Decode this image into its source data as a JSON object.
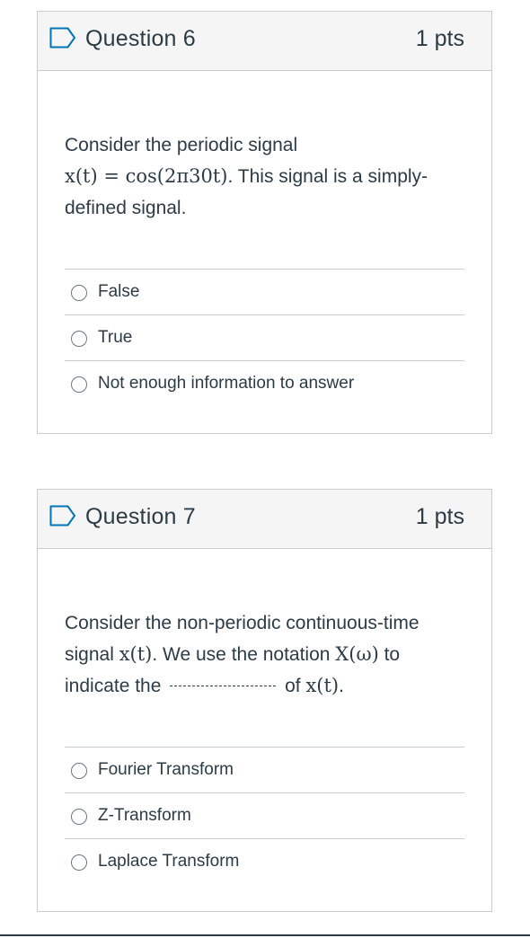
{
  "questions": [
    {
      "title": "Question 6",
      "points": "1 pts",
      "prompt": {
        "line1": "Consider the periodic signal",
        "math": "x(t) = cos(2π30t)",
        "line2_after": ". This signal is a simply-",
        "line3": "defined signal."
      },
      "answers": [
        "False",
        "True",
        "Not enough information to answer"
      ]
    },
    {
      "title": "Question 7",
      "points": "1 pts",
      "prompt": {
        "line1": "Consider the non-periodic continuous-time",
        "line2_before": "signal ",
        "math_signal": "x(t)",
        "line2_mid": ". We use the notation ",
        "math_transform": "X(ω)",
        "line2_after": " to",
        "line3_before": "indicate the ",
        "line3_mid": " of ",
        "math_signal2": "x(t)",
        "line3_after": "."
      },
      "answers": [
        "Fourier Transform",
        "Z-Transform",
        "Laplace Transform"
      ]
    }
  ],
  "icons": {
    "flag": "flag-icon",
    "radio": "radio-icon"
  },
  "colors": {
    "text": "#2d3b45",
    "header_bg": "#f5f5f5",
    "border": "#c7cdd1",
    "flag": "#0374b5"
  }
}
